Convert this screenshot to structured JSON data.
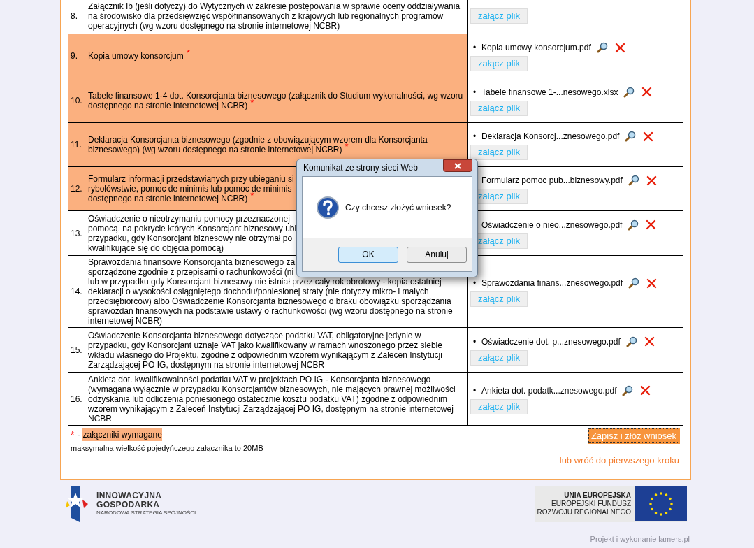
{
  "rows": [
    {
      "number": "8.",
      "highlighted": false,
      "lines": [
        "Załącznik Ib (jeśli dotyczy) do Wytycznych w zakresie postępowania w sprawie oceny oddziaływania",
        "na środowisko dla przedsięwzięć współfinansowanych z krajowych lub regionalnych programów",
        "operacyjnych (wg wzoru dostępnego na stronie internetowej NCBR)"
      ],
      "attach_button": "załącz plik"
    },
    {
      "number": "9.",
      "highlighted": true,
      "lines": [
        "Kopia umowy konsorcjum"
      ],
      "required_mark": "*",
      "file": {
        "bullet": "•",
        "name": "Kopia umowy konsorcjum.pdf"
      },
      "attach_button": "załącz plik"
    },
    {
      "number": "10.",
      "highlighted": true,
      "lines": [
        "Tabele finansowe 1-4 dot. Konsorcjanta biznesowego (załącznik do Studium wykonalności, wg wzoru",
        "dostępnego na stronie internetowej NCBR)"
      ],
      "required_mark": "*",
      "file": {
        "bullet": "•",
        "name": "Tabele finansowe 1-...nesowego.xlsx"
      },
      "attach_button": "załącz plik"
    },
    {
      "number": "11.",
      "highlighted": true,
      "lines": [
        "Deklaracja Konsorcjanta biznesowego (zgodnie z obowiązującym wzorem dla Konsorcjanta",
        "biznesowego) (wg wzoru dostępnego na stronie internetowej NCBR)"
      ],
      "required_mark": "*",
      "file": {
        "bullet": "•",
        "name": "Deklaracja Konsorcj...znesowego.pdf"
      },
      "attach_button": "załącz plik"
    },
    {
      "number": "12.",
      "highlighted": true,
      "lines": [
        "Formularz informacji przedstawianych przy ubieganiu si",
        "rybołówstwie, pomoc de minimis lub pomoc de minimis",
        "dostępnego na stronie internetowej NCBR)"
      ],
      "required_mark": "*",
      "file": {
        "name": "Formularz pomoc pub...biznesowy.pdf"
      },
      "attach_button": "załącz plik"
    },
    {
      "number": "13.",
      "highlighted": false,
      "lines": [
        "Oświadczenie o nieotrzymaniu pomocy przeznaczonej",
        "pomocą, na pokrycie których Konsorcjant biznesowy ubi",
        "przypadku, gdy Konsorcjant biznesowy nie otrzymał po",
        "kwalifikujące się do objęcia pomocą)"
      ],
      "file": {
        "name": "Oświadczenie o nieo...znesowego.pdf"
      },
      "attach_button": "załącz plik"
    },
    {
      "number": "14.",
      "highlighted": false,
      "lines": [
        "Sprawozdania finansowe Konsorcjanta biznesowego za",
        "sporządzone zgodnie z przepisami o rachunkowości (ni",
        "lub w przypadku gdy Konsorcjant biznesowy nie istniał przez cały rok obrotowy - kopia ostatniej",
        "deklaracji o wysokości osiągniętego dochodu/poniesionej straty (nie dotyczy mikro- i małych",
        "przedsiębiorców) albo Oświadczenie Konsorcjanta biznesowego o braku obowiązku sporządzania",
        "sprawozdań finansowych na podstawie ustawy o rachunkowości (wg wzoru dostępnego na stronie",
        "internetowej NCBR)"
      ],
      "file": {
        "bullet": "•",
        "name": "Sprawozdania finans...znesowego.pdf"
      },
      "attach_button": "załącz plik"
    },
    {
      "number": "15.",
      "highlighted": false,
      "lines": [
        "Oświadczenie Konsorcjanta biznesowego dotyczące podatku VAT, obligatoryjne jedynie w",
        "przypadku, gdy Konsorcjant uznaje VAT jako kwalifikowany w ramach wnoszonego przez siebie",
        "wkładu własnego do Projektu, zgodne z odpowiednim wzorem wynikającym z Zaleceń Instytucji",
        "Zarządzającej PO IG, dostępnym na stronie internetowej NCBR"
      ],
      "file": {
        "bullet": "•",
        "name": "Oświadczenie dot. p...znesowego.pdf"
      },
      "attach_button": "załącz plik"
    },
    {
      "number": "16.",
      "highlighted": false,
      "lines": [
        "Ankieta dot. kwalifikowalności podatku VAT w projektach PO IG - Konsorcjanta biznesowego",
        "(wymagana wyłącznie w przypadku Konsorcjantów biznesowych, nie mających prawnej możliwości",
        "odzyskania lub odliczenia poniesionego ostatecznie kosztu podatku VAT) zgodne z odpowiednim",
        "wzorem wynikającym z Zaleceń Instytucji Zarządzającej PO IG, dostępnym na stronie internetowej",
        "NCBR"
      ],
      "file": {
        "bullet": "•",
        "name": "Ankieta dot. podatk...znesowego.pdf"
      },
      "attach_button": "załącz plik"
    }
  ],
  "footer": {
    "legend_mark": "*",
    "legend_dash": "-",
    "legend_text": "załączniki wymagane",
    "note": "maksymalna wielkość pojedyńczego załącznika to 20MB",
    "submit_button": "Zapisz i złóż wniosek",
    "back_link": "lub wróć do pierwszego kroku"
  },
  "dialog": {
    "title": "Komunikat ze strony sieci Web",
    "message": "Czy chcesz złożyć wniosek?",
    "buttons": [
      {
        "label": "OK",
        "default": true
      },
      {
        "label": "Anuluj",
        "default": false
      }
    ]
  },
  "logos": {
    "left": {
      "line1": "INNOWACYJNA",
      "line2": "GOSPODARKA",
      "tagline": "NARODOWA STRATEGIA SPÓJNOŚCI"
    },
    "right": {
      "line1": "UNIA EUROPEJSKA",
      "line2": "EUROPEJSKI FUNDUSZ",
      "line3": "ROZWOJU REGIONALNEGO"
    }
  },
  "credit": "Projekt i wykonanie lamers.pl"
}
